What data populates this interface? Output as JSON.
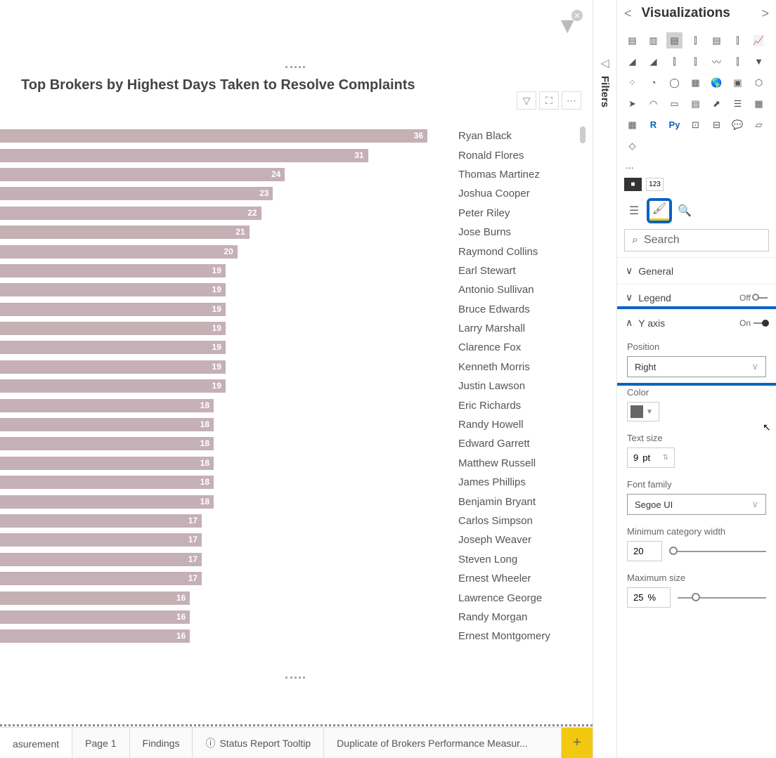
{
  "chart_data": {
    "type": "bar",
    "title": "Top Brokers by Highest Days Taken to Resolve Complaints",
    "xlabel": "",
    "ylabel": "",
    "orientation": "horizontal",
    "y_axis_position": "Right",
    "categories": [
      "Ryan Black",
      "Ronald Flores",
      "Thomas Martinez",
      "Joshua Cooper",
      "Peter Riley",
      "Jose Burns",
      "Raymond Collins",
      "Earl Stewart",
      "Antonio Sullivan",
      "Bruce Edwards",
      "Larry Marshall",
      "Clarence Fox",
      "Kenneth Morris",
      "Justin Lawson",
      "Eric Richards",
      "Randy Howell",
      "Edward Garrett",
      "Matthew Russell",
      "James Phillips",
      "Benjamin Bryant",
      "Carlos Simpson",
      "Joseph Weaver",
      "Steven Long",
      "Ernest Wheeler",
      "Lawrence George",
      "Randy Morgan",
      "Ernest Montgomery"
    ],
    "values": [
      36,
      31,
      24,
      23,
      22,
      21,
      20,
      19,
      19,
      19,
      19,
      19,
      19,
      19,
      18,
      18,
      18,
      18,
      18,
      18,
      17,
      17,
      17,
      17,
      16,
      16,
      16
    ]
  },
  "viz_panel": {
    "title": "Visualizations",
    "dots": "...",
    "chip_val": "123",
    "search_placeholder": "Search",
    "sections": {
      "general": "General",
      "legend": {
        "label": "Legend",
        "state": "Off"
      },
      "yaxis": {
        "label": "Y axis",
        "state": "On",
        "position_label": "Position",
        "position_value": "Right",
        "color_label": "Color",
        "text_size_label": "Text size",
        "text_size_value": "9",
        "text_size_unit": "pt",
        "font_label": "Font family",
        "font_value": "Segoe UI",
        "min_cat_label": "Minimum category width",
        "min_cat_value": "20",
        "max_size_label": "Maximum size",
        "max_size_value": "25",
        "max_size_unit": "%"
      }
    }
  },
  "filters_label": "Filters",
  "pages": {
    "tabs": [
      "asurement",
      "Page 1",
      "Findings",
      "Status Report Tooltip",
      "Duplicate of Brokers Performance Measur..."
    ]
  }
}
